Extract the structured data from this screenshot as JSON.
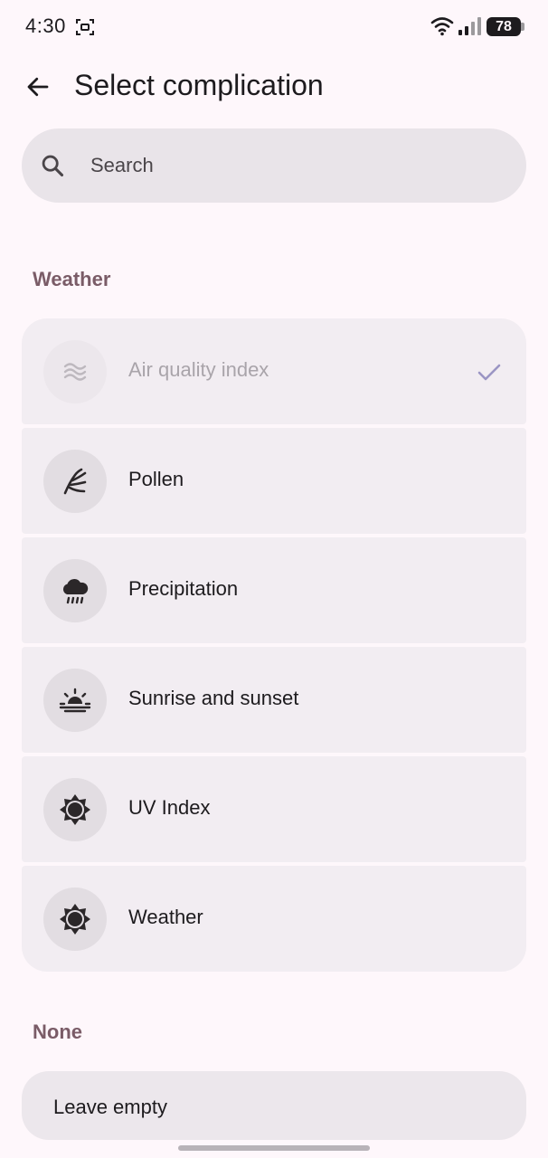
{
  "status_bar": {
    "time": "4:30",
    "battery": "78",
    "icons": [
      "screen-record-icon",
      "wifi-icon",
      "signal-icon",
      "battery-icon"
    ]
  },
  "header": {
    "back_icon": "arrow-left-icon",
    "title": "Select complication"
  },
  "search": {
    "icon": "search-icon",
    "placeholder": "Search"
  },
  "sections": {
    "weather": {
      "title": "Weather",
      "items": [
        {
          "label": "Air quality index",
          "icon": "air-quality-icon",
          "selected": true,
          "disabled": true
        },
        {
          "label": "Pollen",
          "icon": "pollen-icon"
        },
        {
          "label": "Precipitation",
          "icon": "precipitation-icon"
        },
        {
          "label": "Sunrise and sunset",
          "icon": "sunrise-icon"
        },
        {
          "label": "UV Index",
          "icon": "uv-index-icon"
        },
        {
          "label": "Weather",
          "icon": "weather-icon"
        }
      ]
    },
    "none": {
      "title": "None",
      "items": [
        {
          "label": "Leave empty"
        }
      ]
    }
  },
  "colors": {
    "background": "#FEF7FB",
    "surface": "#F2EDF2",
    "section_header": "#7A5C67",
    "icon_circle": "#E2DDE2",
    "check": "#9B95C4"
  }
}
